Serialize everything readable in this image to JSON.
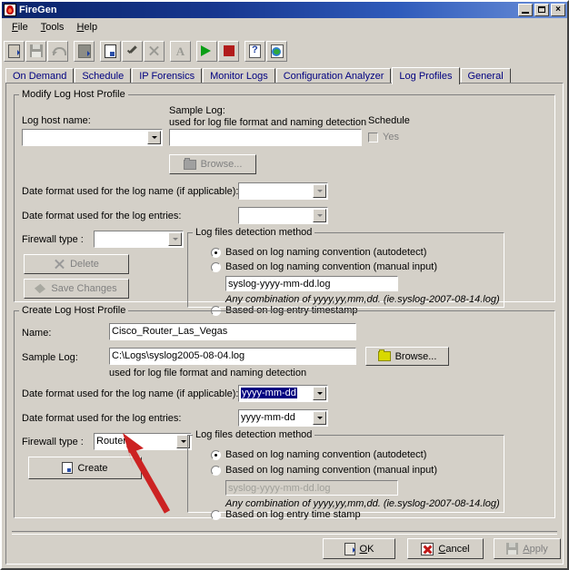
{
  "window": {
    "title": "FireGen",
    "icon": "flame-icon",
    "controls": {
      "minimize": "_",
      "maximize": "□",
      "close": "×"
    }
  },
  "menu": [
    {
      "label": "File",
      "accel": "F"
    },
    {
      "label": "Tools",
      "accel": "T"
    },
    {
      "label": "Help",
      "accel": "H"
    }
  ],
  "toolbar": [
    {
      "name": "exit-icon",
      "enabled": true
    },
    {
      "name": "save-icon",
      "enabled": false
    },
    {
      "name": "undo-icon",
      "enabled": false
    },
    {
      "name": "report-icon",
      "enabled": true
    },
    {
      "name": "new-document-icon",
      "enabled": true
    },
    {
      "name": "apply-check-icon",
      "enabled": true
    },
    {
      "name": "delete-x-icon",
      "enabled": false
    },
    {
      "name": "text-format-icon",
      "enabled": false
    },
    {
      "name": "run-play-icon",
      "enabled": true
    },
    {
      "name": "stop-icon",
      "enabled": true
    },
    {
      "name": "help-icon",
      "enabled": true
    },
    {
      "name": "web-update-icon",
      "enabled": true
    }
  ],
  "tabs": [
    {
      "label": "On Demand",
      "active": false
    },
    {
      "label": "Schedule",
      "active": false
    },
    {
      "label": "IP Forensics",
      "active": false
    },
    {
      "label": "Monitor Logs",
      "active": false
    },
    {
      "label": "Configuration Analyzer",
      "active": false
    },
    {
      "label": "Log Profiles",
      "active": true
    },
    {
      "label": "General",
      "active": false
    }
  ],
  "modify_group": {
    "legend": "Modify Log Host Profile",
    "log_host_name_label": "Log host name:",
    "log_host_name_value": "",
    "sample_log_label": "Sample Log:",
    "sample_log_sub": "used for log file format and naming detection",
    "sample_log_value": "",
    "schedule_label": "Schedule",
    "schedule_yes_label": "Yes",
    "browse_label": "Browse...",
    "date_format_name_label": "Date format used for the log name (if applicable):",
    "date_format_name_value": "",
    "date_format_entries_label": "Date format used for the log entries:",
    "date_format_entries_value": "",
    "firewall_type_label": "Firewall type :",
    "firewall_type_value": "",
    "delete_label": "Delete",
    "save_changes_label": "Save Changes",
    "detection": {
      "legend": "Log files detection method",
      "option_autodetect": "Based on log naming convention (autodetect)",
      "option_manual": "Based on log naming convention (manual input)",
      "manual_pattern": "syslog-yyyy-mm-dd.log",
      "hint": "Any combination of yyyy,yy,mm,dd. (ie.syslog-2007-08-14.log)",
      "option_timestamp": "Based on log entry timestamp",
      "selected": "autodetect"
    }
  },
  "create_group": {
    "legend": "Create Log Host Profile",
    "name_label": "Name:",
    "name_value": "Cisco_Router_Las_Vegas",
    "sample_log_label": "Sample Log:",
    "sample_log_value": "C:\\Logs\\syslog2005-08-04.log",
    "sample_log_sub": "used for log file format and naming detection",
    "browse_label": "Browse...",
    "date_format_name_label": "Date format used for the log name (if applicable):",
    "date_format_name_value": "yyyy-mm-dd",
    "date_format_entries_label": "Date format used for the log entries:",
    "date_format_entries_value": "yyyy-mm-dd",
    "firewall_type_label": "Firewall type :",
    "firewall_type_value": "Router",
    "create_label": "Create",
    "detection": {
      "legend": "Log files detection method",
      "option_autodetect": "Based on log naming convention (autodetect)",
      "option_manual": "Based on log naming convention (manual input)",
      "manual_pattern": "syslog-yyyy-mm-dd.log",
      "hint": "Any combination of yyyy,yy,mm,dd. (ie.syslog-2007-08-14.log)",
      "option_timestamp": "Based on log entry time stamp",
      "selected": "autodetect"
    }
  },
  "dialog_buttons": {
    "ok_label": "OK",
    "ok_accel": "O",
    "cancel_label": "Cancel",
    "cancel_accel": "C",
    "apply_label": "Apply",
    "apply_accel": "A"
  },
  "annotation": {
    "type": "arrow",
    "color": "#cc2222",
    "points_at": "create-firewall-type-combo"
  }
}
